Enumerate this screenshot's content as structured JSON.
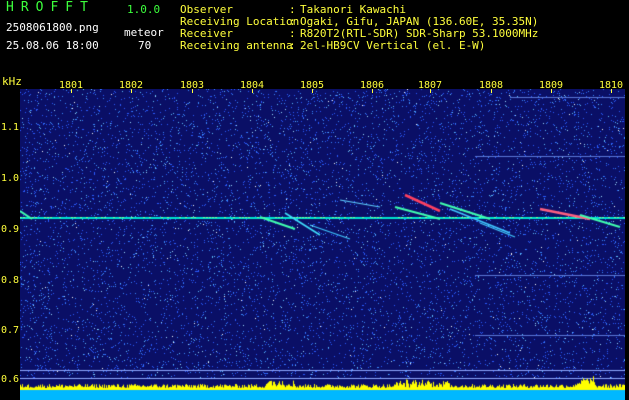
{
  "header": {
    "app_title": "HROFFT",
    "version": "1.0.0",
    "file_name": "2508061800.png",
    "datetime": "25.08.06 18:00",
    "mode_label": "meteor",
    "count_value": "70"
  },
  "info": [
    {
      "key": "Observer",
      "value": "Takanori Kawachi"
    },
    {
      "key": "Receiving Location",
      "value": "Ogaki, Gifu, JAPAN (136.60E, 35.35N)"
    },
    {
      "key": "Receiver",
      "value": "R820T2(RTL-SDR) SDR-Sharp 53.1000MHz"
    },
    {
      "key": "Receiving antenna",
      "value": "2el-HB9CV Vertical (el. E-W)"
    }
  ],
  "axes": {
    "y_unit": "kHz",
    "y_ticks": [
      "1.1",
      "1.0",
      "0.9",
      "0.8",
      "0.7",
      "0.6"
    ],
    "x_ticks": [
      "1801",
      "1802",
      "1803",
      "1804",
      "1805",
      "1806",
      "1807",
      "1808",
      "1809",
      "1810"
    ]
  },
  "colors": {
    "background": "#0a0f66",
    "carrier": "#00e5d0",
    "level": "#ffff00",
    "baseline": "#00b8ff",
    "label": "#ffff3c",
    "title": "#3cff3c"
  }
}
